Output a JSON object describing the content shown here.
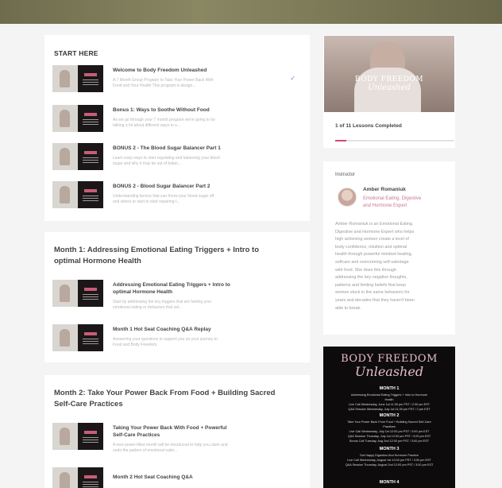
{
  "start_here": {
    "title": "START HERE",
    "lessons": [
      {
        "title": "Welcome to Body Freedom Unleashed",
        "desc1": "A 7 Month Group Program to Take Your Power Back With",
        "desc2": "Food and Your Health This program is design...",
        "completed": true
      },
      {
        "title": "Bonus 1: Ways to Soothe Without Food",
        "desc1": "As we go through your 7 month program we're going to be",
        "desc2": "talking a lot about different ways to s...",
        "completed": false
      },
      {
        "title": "BONUS 2 - The Blood Sugar Balancer Part 1",
        "desc1": "Learn easy ways to start regulating and balancing your blood",
        "desc2": "sugar and why it may be out of balan...",
        "completed": false
      },
      {
        "title": "BONUS 2 - Blood Sugar Balancer Part 2",
        "desc1": "Understanding factors that can throw your blood sugar off",
        "desc2": "and where to start to start repairing t...",
        "completed": false
      }
    ]
  },
  "month1": {
    "title_line1": "Month 1: Addressing Emotional Eating Triggers + Intro to",
    "title_line2": "optimal Hormone Health",
    "lessons": [
      {
        "title_line1": "Addressing Emotional Eating Triggers + Intro to",
        "title_line2": "optimal Hormone Health",
        "desc1": "Start by addressing the key triggers that are fueling your",
        "desc2": "emotional eating or behaviors that sel..."
      },
      {
        "title_line1": "Month 1 Hot Seat Coaching Q&A Replay",
        "title_line2": "",
        "desc1": "Answering your questions to support you on your journey to",
        "desc2": "Food and Body Freedom."
      }
    ]
  },
  "month2": {
    "title_line1": "Month 2: Take Your Power Back From Food + Building Sacred",
    "title_line2": "Self-Care Practices",
    "lessons": [
      {
        "title_line1": "Taking Your Power Back With Food + Powerful",
        "title_line2": "Self-Care Practices",
        "desc1": "A new power-filled month will be introduced to help you claim and",
        "desc2": "undo the pattern of emotional eatin..."
      },
      {
        "title_line1": "Month 2 Hot Seat Coaching Q&A",
        "title_line2": "",
        "desc1": "",
        "desc2": ""
      }
    ]
  },
  "course": {
    "image_text_line1": "BODY FREEDOM",
    "image_text_line2": "Unleashed",
    "progress_text": "1 of 11 Lessons Completed",
    "progress_fraction": 0.09
  },
  "instructor": {
    "label": "Instructor",
    "name": "Amber Romaniuk",
    "role_line1": "Emotional Eating, Digestive",
    "role_line2": "and Hormone Expert",
    "bio": [
      "Amber Romaniuk is an Emotional Eating,",
      "Digestive and Hormone Expert who helps",
      "high achieving women create a level of",
      "body confidence, intuition and optimal",
      "health through powerful mindset healing,",
      "selfcare and overcoming self-sabotage",
      "with food. She does this through",
      "addressing the key negative thoughts,",
      "patterns and limiting beliefs that keep",
      "women stuck in the same behaviors for",
      "years and decades that they haven't been",
      "able to break."
    ]
  },
  "promo": {
    "brand": "BODY FREEDOM",
    "script": "Unleashed",
    "month1": "MONTH 1",
    "month1_lines": [
      "Addressing Emotional Eating Triggers + Intro to Hormone",
      "Health",
      "Live Call  Wednesday, June 1st   11:30 pm PST / 2:30 pm EST",
      "Q&A Session    Wednesday, July 1st  11:30 pm PST / 2 pm EST"
    ],
    "month2": "MONTH 2",
    "month2_lines": [
      "Take Your Power Back From Food + Building Sacred Self-Care",
      "Practices",
      "Live Call  Wednesday, July 1st    12:00 pm PST / 3:00 pm EST",
      "Q&A Session   Thursday, July 1st   12:00 pm PST / 3:00 pm EST",
      "Bonus Call  Tuesday, Aug 2nd   12:00 pm PST / 3:00 pm EST"
    ],
    "month3": "MONTH 3",
    "month3_lines": [
      "Gut Happy Digestion And Hormone Practice",
      "Live Call  Wednesday, August 1st   12:00 pm PST / 3:00 pm EST",
      "Q&A Session   Thursday, August 2nd   12:00 pm PST / 3:00 pm EST"
    ],
    "month4": "MONTH 4"
  },
  "colors": {
    "accent": "#c94d6f",
    "check": "#6c7fd6",
    "topbar": "#7c7a58"
  }
}
